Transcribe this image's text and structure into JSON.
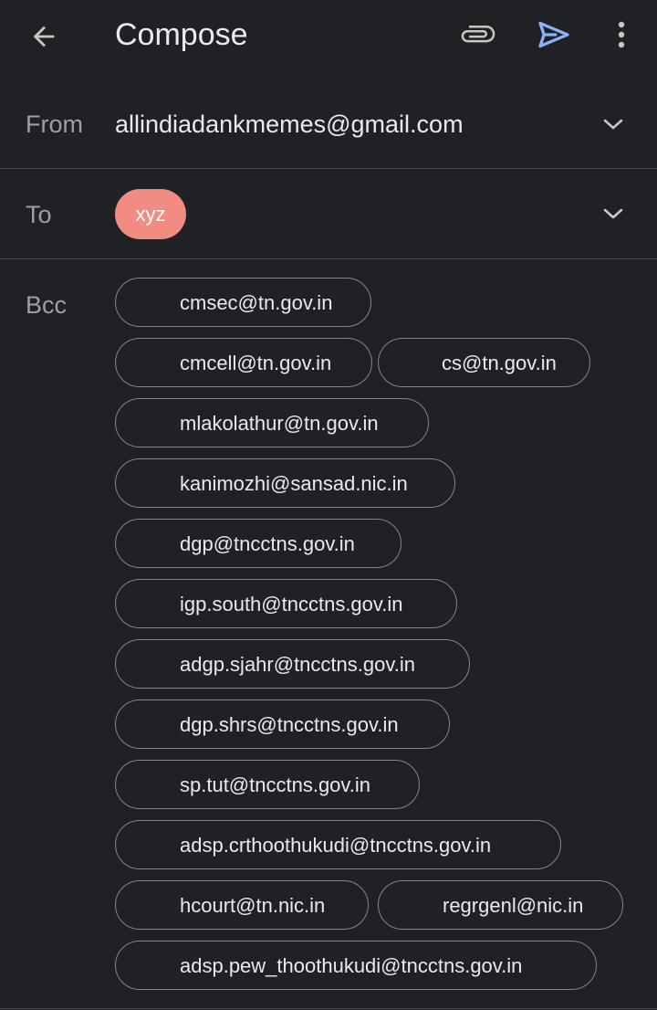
{
  "header": {
    "title": "Compose",
    "icons": {
      "back": "arrow-back-icon",
      "attach": "paperclip-icon",
      "send": "send-icon",
      "more": "more-vert-icon"
    },
    "send_color": "#8ab4f8"
  },
  "from": {
    "label": "From",
    "value": "allindiadankmemes@gmail.com"
  },
  "to": {
    "label": "To",
    "recipients": [
      "xyz"
    ],
    "chip_color": "#f28b82"
  },
  "bcc": {
    "label": "Bcc",
    "recipients": [
      "cmsec@tn.gov.in",
      "cmcell@tn.gov.in",
      "cs@tn.gov.in",
      "mlakolathur@tn.gov.in",
      "kanimozhi@sansad.nic.in",
      "dgp@tncctns.gov.in",
      "igp.south@tncctns.gov.in",
      "adgp.sjahr@tncctns.gov.in",
      "dgp.shrs@tncctns.gov.in",
      "sp.tut@tncctns.gov.in",
      "adsp.crthoothukudi@tncctns.gov.in",
      "hcourt@tn.nic.in",
      "regrgenl@nic.in",
      "adsp.pew_thoothukudi@tncctns.gov.in"
    ]
  },
  "colors": {
    "background": "#202124",
    "text": "#e8eaed",
    "label": "#9aa0a6",
    "chip_border": "#80868b",
    "accent": "#8ab4f8"
  }
}
